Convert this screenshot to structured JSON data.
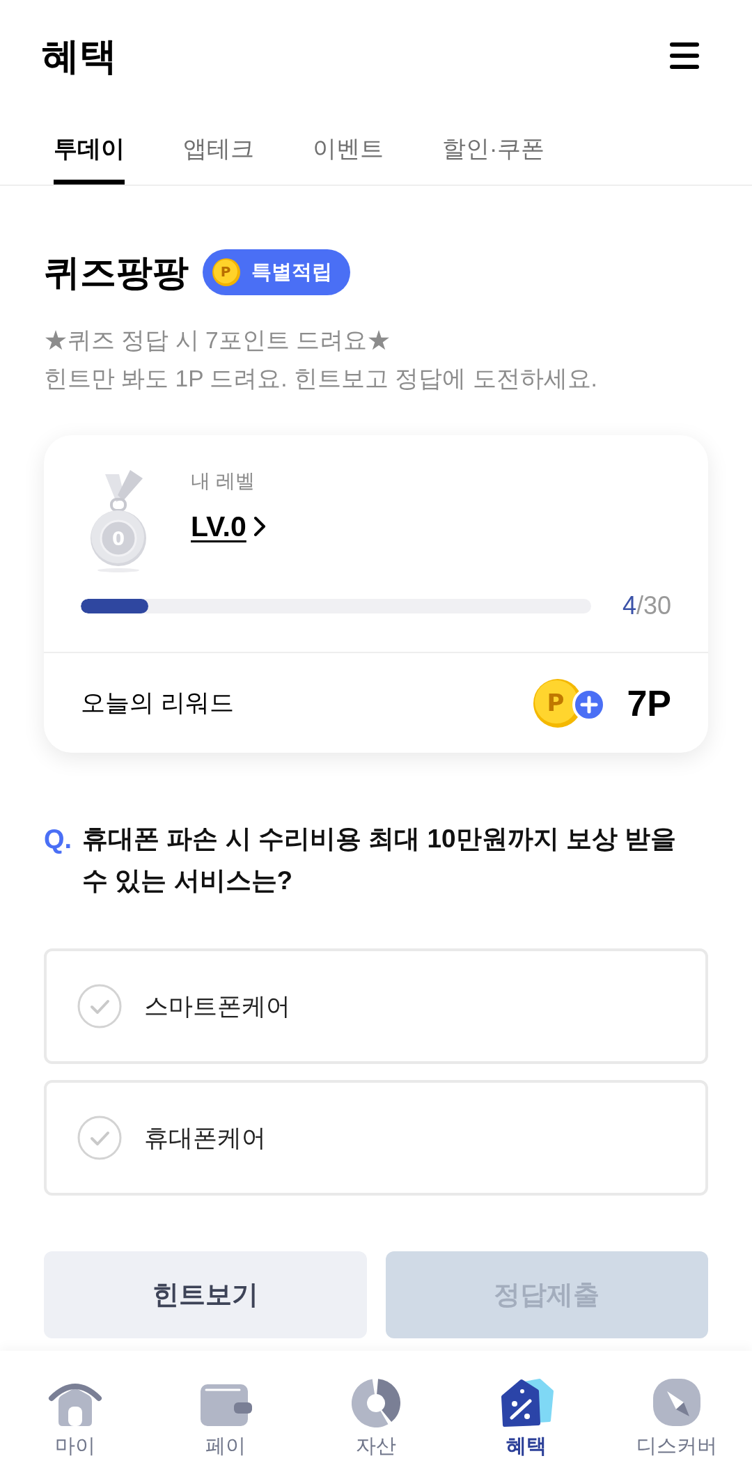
{
  "header": {
    "title": "혜택"
  },
  "tabs": [
    {
      "label": "투데이",
      "selected": true
    },
    {
      "label": "앱테크",
      "selected": false
    },
    {
      "label": "이벤트",
      "selected": false
    },
    {
      "label": "할인·쿠폰",
      "selected": false
    }
  ],
  "quiz": {
    "title": "퀴즈팡팡",
    "badge": {
      "coin_mark": "P",
      "label": "특별적립"
    },
    "description": [
      "★퀴즈 정답 시 7포인트 드려요★",
      "힌트만 봐도 1P 드려요. 힌트보고 정답에 도전하세요."
    ]
  },
  "level_card": {
    "medal_number": "0",
    "label": "내 레벨",
    "level_name": "LV.0",
    "progress": {
      "level": 0.133,
      "count": "4",
      "goal": "/30"
    },
    "reward_label": "오늘의 리워드",
    "coin_mark": "P",
    "reward": "7P"
  },
  "question": {
    "marker": "Q.",
    "text": "휴대폰 파손 시 수리비용 최대 10만원까지 보상 받을 수 있는 서비스는?"
  },
  "options": [
    {
      "label": "스마트폰케어",
      "selected": false
    },
    {
      "label": "휴대폰케어",
      "selected": false
    }
  ],
  "buttons": [
    {
      "label": "힌트보기",
      "kind": "secondary",
      "disabled": false
    },
    {
      "label": "정답제출",
      "kind": "primary",
      "disabled": true
    }
  ],
  "bottom_nav": [
    {
      "label": "마이",
      "selected": false
    },
    {
      "label": "페이",
      "selected": false
    },
    {
      "label": "자산",
      "selected": false
    },
    {
      "label": "혜택",
      "selected": true
    },
    {
      "label": "디스커버",
      "selected": false
    }
  ]
}
